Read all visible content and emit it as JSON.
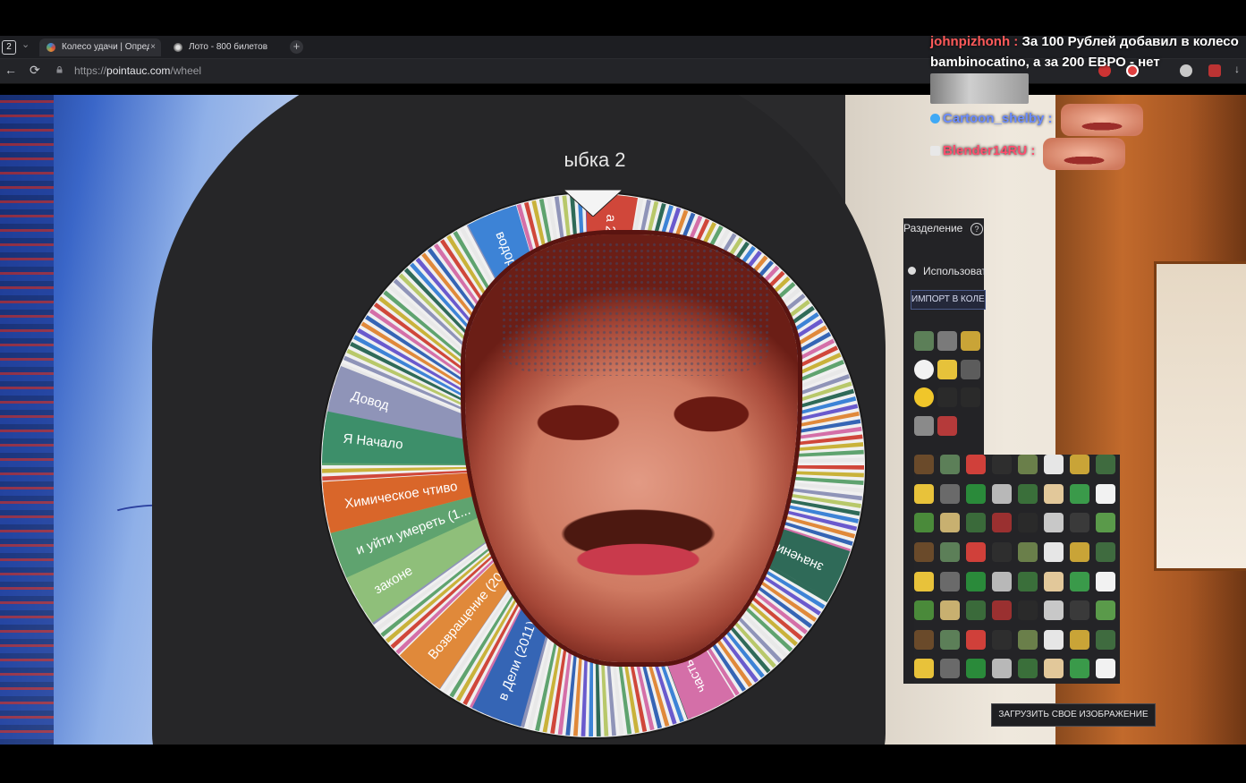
{
  "browser": {
    "tab_count": "2",
    "tabs": [
      {
        "label": "Колесо удачи | Определ",
        "close": "×"
      },
      {
        "label": "Лото - 800 билетов",
        "close": ""
      }
    ],
    "new_tab": "+",
    "url_prefix": "https://",
    "url_domain": "pointauc.com",
    "url_path": "/wheel"
  },
  "wheel": {
    "title": "ыбка 2",
    "segments": [
      {
        "label": "водород",
        "color": "#3d83d6"
      },
      {
        "label": "а 2",
        "color": "#d0473a"
      },
      {
        "label": "Довод",
        "color": "#8f94b8"
      },
      {
        "label": "Я Начало",
        "color": "#3d8f6a"
      },
      {
        "label": "Химическое чтиво",
        "color": "#d9662a"
      },
      {
        "label": "и уйти умереть (1...",
        "color": "#5fa36f"
      },
      {
        "label": "законе",
        "color": "#8fbf7a"
      },
      {
        "label": "Возвращение (2010)",
        "color": "#e0893a"
      },
      {
        "label": "в Дели (2011)",
        "color": "#3565b5"
      },
      {
        "label": "часть",
        "color": "#d46fa8"
      },
      {
        "label": "значения",
        "color": "#2f6a58"
      }
    ]
  },
  "panel": {
    "split_label": "Разделение",
    "help": "?",
    "use_option": "Использоват",
    "import_button": "ИМПОРТ В КОЛЕ",
    "upload_button": "ЗАГРУЗИТЬ СВОЕ ИЗОБРАЖЕНИЕ"
  },
  "chat": {
    "msg1_user": "johnpizhonh :",
    "msg1_text": "За 100 Рублей добавил в колесо",
    "msg2_text": "bambinocatino, а за 200 ЕВРО - нет",
    "user2": "Cartoon_shelby :",
    "user3": "Blender14RU :"
  },
  "colors": {
    "chat_user1": "#ff5a5a",
    "chat_user2": "#6b8cff",
    "chat_user3": "#ff4f6e",
    "accent": "#3d83d6"
  }
}
